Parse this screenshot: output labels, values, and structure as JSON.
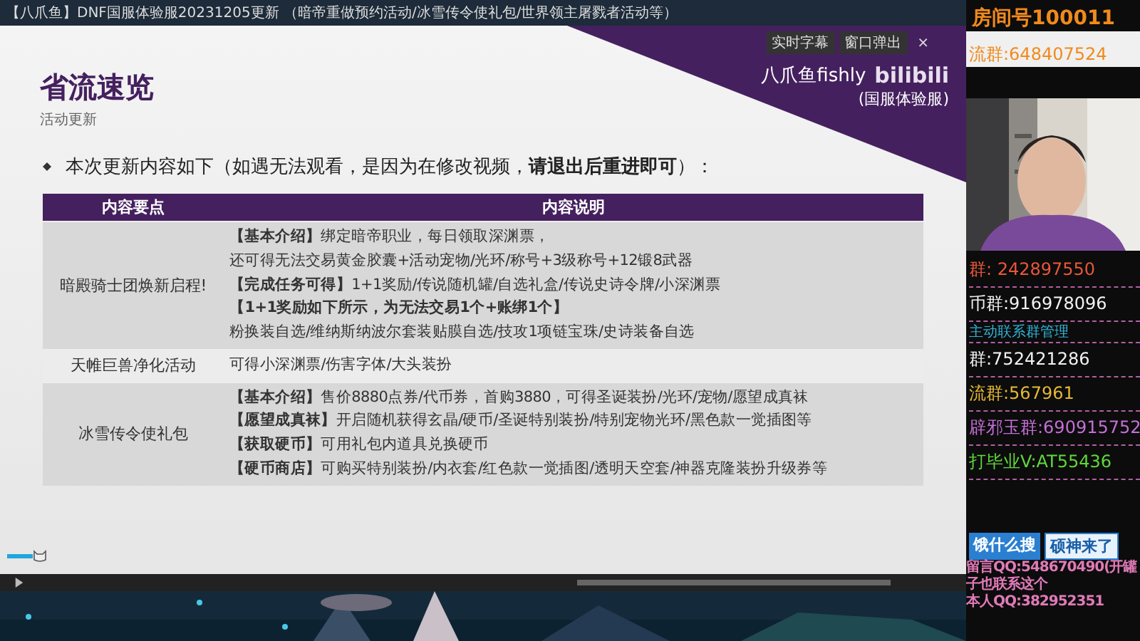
{
  "video_title": "【八爪鱼】DNF国服体验服20231205更新 （暗帝重做预约活动/冰雪传令使礼包/世界领主屠戮者活动等）",
  "player_buttons": [
    "实时字幕",
    "窗口弹出",
    "×"
  ],
  "slide": {
    "brand": "八爪鱼fishly",
    "brand_logo": "bilibili",
    "server": "(国服体验服)",
    "title": "省流速览",
    "subtitle": "活动更新",
    "intro": "本次更新内容如下（如遇无法观看，是因为在修改视频，**请退出后重进即可**）：",
    "table": {
      "columns": [
        "内容要点",
        "内容说明"
      ],
      "rows": [
        {
          "topic": "暗殿骑士团焕新启程!",
          "lines": [
            "**【基本介绍】**绑定暗帝职业，每日领取深渊票，",
            "还可得无法交易黄金胶囊+活动宠物/光环/称号+3级称号+12锻8武器",
            "**【完成任务可得】**1+1奖励/传说随机罐/自选礼盒/传说史诗令牌/小深渊票",
            "**【1+1奖励如下所示，为无法交易1个+账绑1个】**",
            "粉换装自选/维纳斯纳波尔套装贴膜自选/技攻1项链宝珠/史诗装备自选"
          ]
        },
        {
          "topic": "天帷巨兽净化活动",
          "lines": [
            "可得小深渊票/伤害字体/大头装扮"
          ]
        },
        {
          "topic": "冰雪传令使礼包",
          "lines": [
            "**【基本介绍】**售价8880点券/代币券，首购3880，可得圣诞装扮/光环/宠物/愿望成真袜",
            "**【愿望成真袜】**开启随机获得玄晶/硬币/圣诞特别装扮/特别宠物光环/黑色款一觉插图等",
            "**【获取硬币】**可用礼包内道具兑换硬币",
            "**【硬币商店】**可购买特别装扮/内衣套/红色款一觉插图/透明天空套/神器克隆装扮升级券等"
          ]
        }
      ]
    }
  },
  "playback": {
    "level": 0.035
  },
  "overlay": {
    "room": "房间号100011",
    "top_group": "流群:648407524",
    "groups": [
      {
        "text": "群: 242897550",
        "color": "#e8573a"
      },
      {
        "text": "币群:916978096",
        "color": "#f2f2f2"
      },
      {
        "text": "主动联系群管理",
        "color": "#2fb3d6"
      },
      {
        "text": "群:752421286",
        "color": "#f2f2f2"
      },
      {
        "text": "流群:567961",
        "color": "#e6b836"
      },
      {
        "text": "辟邪玉群:690915752",
        "color": "#c56fd8"
      },
      {
        "text": "打毕业V:AT55436",
        "color": "#5fd83a"
      }
    ],
    "search_tag": "饿什么搜",
    "banner": "硕神来了",
    "contacts": [
      "留言QQ:548670490(开罐子也联系这个",
      "本人QQ:382952351"
    ]
  }
}
